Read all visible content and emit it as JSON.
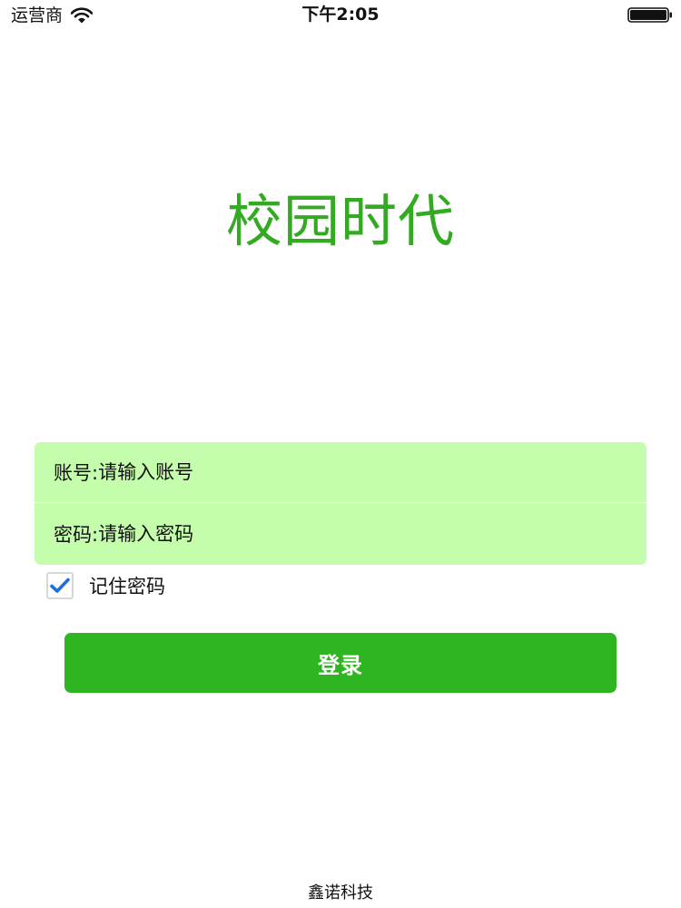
{
  "status_bar": {
    "carrier": "运营商",
    "time": "下午2:05",
    "icons": [
      "wifi-icon",
      "battery-icon"
    ]
  },
  "app": {
    "title": "校园时代"
  },
  "form": {
    "account": {
      "label": "账号:",
      "placeholder": "请输入账号",
      "value": ""
    },
    "password": {
      "label": "密码:",
      "placeholder": "请输入密码",
      "value": ""
    },
    "remember": {
      "label": "记住密码",
      "checked": true
    },
    "submit_label": "登录"
  },
  "footer": {
    "company": "鑫诺科技"
  },
  "colors": {
    "brand_green": "#33aa22",
    "button_green": "#2fb521",
    "card_green": "#c4fdac",
    "check_blue": "#1c6fe0"
  }
}
